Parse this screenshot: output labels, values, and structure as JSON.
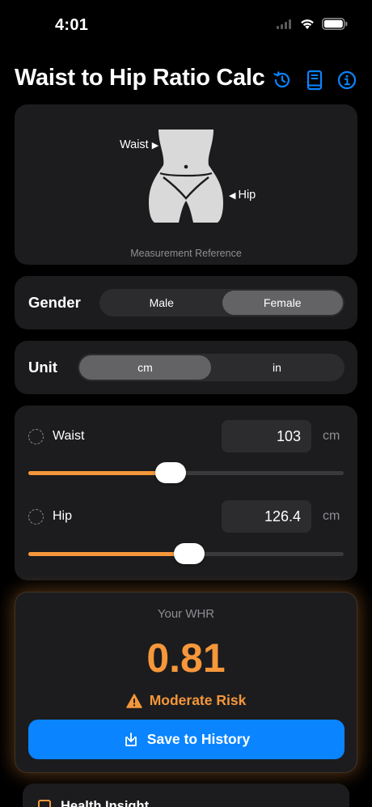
{
  "status_bar": {
    "time": "4:01"
  },
  "header": {
    "title": "Waist to Hip Ratio Calc",
    "icons": [
      "history-icon",
      "book-icon",
      "info-icon"
    ],
    "accent_color": "#0a84ff"
  },
  "reference": {
    "waist_label": "Waist",
    "hip_label": "Hip",
    "caption": "Measurement Reference"
  },
  "gender": {
    "label": "Gender",
    "options": [
      "Male",
      "Female"
    ],
    "selected": "Female"
  },
  "unit": {
    "label": "Unit",
    "options": [
      "cm",
      "in"
    ],
    "selected": "cm"
  },
  "measurements": {
    "waist": {
      "label": "Waist",
      "value": "103",
      "unit": "cm",
      "slider_fraction": 0.45
    },
    "hip": {
      "label": "Hip",
      "value": "126.4",
      "unit": "cm",
      "slider_fraction": 0.51
    }
  },
  "result": {
    "label": "Your WHR",
    "value": "0.81",
    "risk": "Moderate Risk",
    "save_button": "Save to History",
    "accent_color": "#f5973a"
  },
  "insight": {
    "title": "Health Insight"
  }
}
